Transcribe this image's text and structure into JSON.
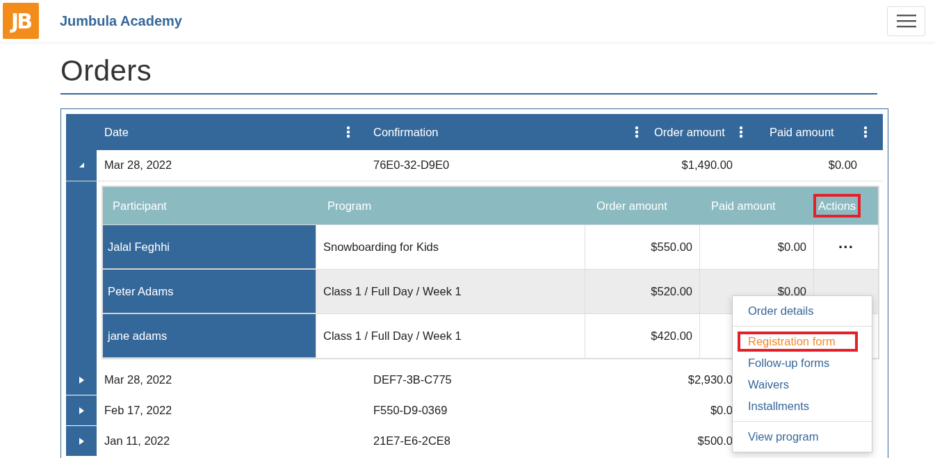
{
  "brand": {
    "logo": "JB",
    "name": "Jumbula Academy"
  },
  "page_title": "Orders",
  "orders": {
    "columns": [
      "Date",
      "Confirmation",
      "Order amount",
      "Paid amount"
    ],
    "rows": [
      {
        "expanded": true,
        "date": "Mar 28, 2022",
        "confirmation": "76E0-32-D9E0",
        "order_amount": "$1,490.00",
        "paid_amount": "$0.00",
        "details": {
          "columns": [
            {
              "label": "Participant",
              "highlighted": false
            },
            {
              "label": "Program",
              "highlighted": false
            },
            {
              "label": "Order amount",
              "highlighted": false
            },
            {
              "label": "Paid amount",
              "highlighted": false
            },
            {
              "label": "Actions",
              "highlighted": true
            }
          ],
          "rows": [
            {
              "participant": "Jalal Feghhi",
              "program": "Snowboarding for Kids",
              "order_amount": "$550.00",
              "paid_amount": "$0.00",
              "actions": "···"
            },
            {
              "participant": "Peter Adams",
              "program": "Class 1 / Full Day / Week 1",
              "order_amount": "$520.00",
              "paid_amount": "$0.00"
            },
            {
              "participant": "jane adams",
              "program": "Class 1 / Full Day / Week 1",
              "order_amount": "$420.00"
            }
          ]
        }
      },
      {
        "expanded": false,
        "date": "Mar 28, 2022",
        "confirmation": "DEF7-3B-C775",
        "order_amount": "$2,930.0"
      },
      {
        "expanded": false,
        "date": "Feb 17, 2022",
        "confirmation": "F550-D9-0369",
        "order_amount": "$0.0"
      },
      {
        "expanded": false,
        "date": "Jan 11, 2022",
        "confirmation": "21E7-E6-2CE8",
        "order_amount": "$500.0"
      }
    ]
  },
  "actions_menu": {
    "groups": [
      [
        {
          "label": "Order details",
          "active": false,
          "highlighted": false
        }
      ],
      [
        {
          "label": "Registration form",
          "active": true,
          "highlighted": true
        },
        {
          "label": "Follow-up forms",
          "active": false,
          "highlighted": false
        },
        {
          "label": "Waivers",
          "active": false,
          "highlighted": false
        },
        {
          "label": "Installments",
          "active": false,
          "highlighted": false
        }
      ],
      [
        {
          "label": "View program",
          "active": false,
          "highlighted": false
        }
      ]
    ]
  }
}
